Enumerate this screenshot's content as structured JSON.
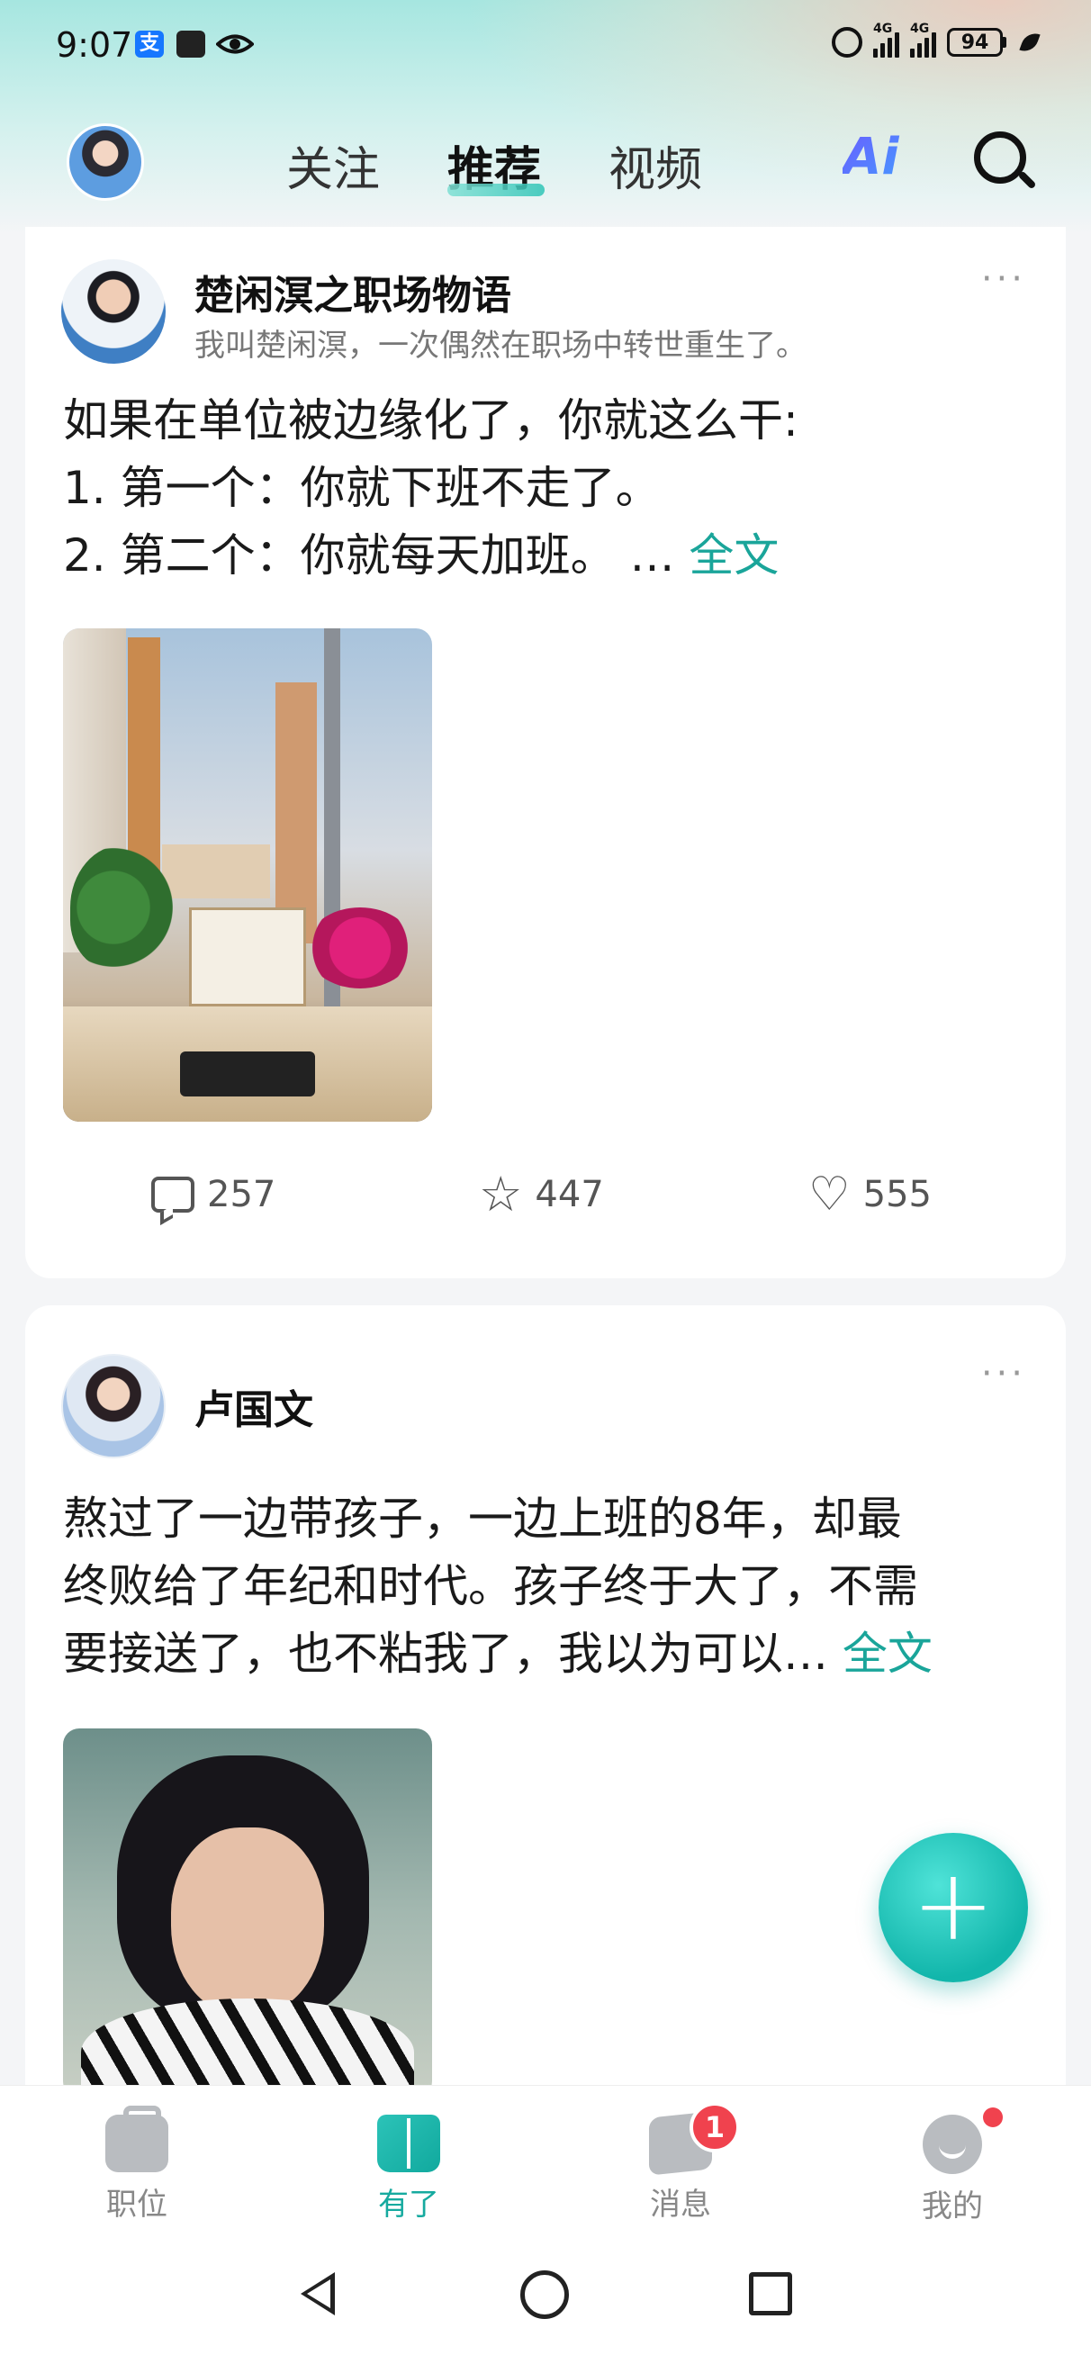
{
  "status_bar": {
    "time": "9:07",
    "alipay_glyph": "支",
    "network_1": "4G",
    "network_2": "4G",
    "battery": "94"
  },
  "header": {
    "tabs": [
      {
        "label": "关注",
        "active": false
      },
      {
        "label": "推荐",
        "active": true
      },
      {
        "label": "视频",
        "active": false
      }
    ],
    "ai_label": "Ai",
    "accent_color": "#1aa59a"
  },
  "feed": [
    {
      "author": "楚闲溟之职场物语",
      "bio": "我叫楚闲溟，一次偶然在职场中转世重生了。",
      "lines": [
        "如果在单位被边缘化了，你就这么干:",
        "1. 第一个：你就下班不走了。",
        "2. 第二个：你就每天加班。 … "
      ],
      "more_link": "全文",
      "comments": "257",
      "stars": "447",
      "likes": "555"
    },
    {
      "author": "卢国文",
      "lines": [
        "熬过了一边带孩子，一边上班的8年，却最",
        "终败给了年纪和时代。孩子终于大了，不需",
        "要接送了，也不粘我了，我以为可以… "
      ],
      "more_link": "全文"
    }
  ],
  "fab_symbol": "+",
  "tabbar": {
    "items": [
      {
        "label": "职位",
        "icon": "briefcase-icon",
        "active": false
      },
      {
        "label": "有了",
        "icon": "book-icon",
        "active": true
      },
      {
        "label": "消息",
        "icon": "message-icon",
        "active": false
      },
      {
        "label": "我的",
        "icon": "smile-icon",
        "active": false
      }
    ],
    "message_badge": "1"
  }
}
